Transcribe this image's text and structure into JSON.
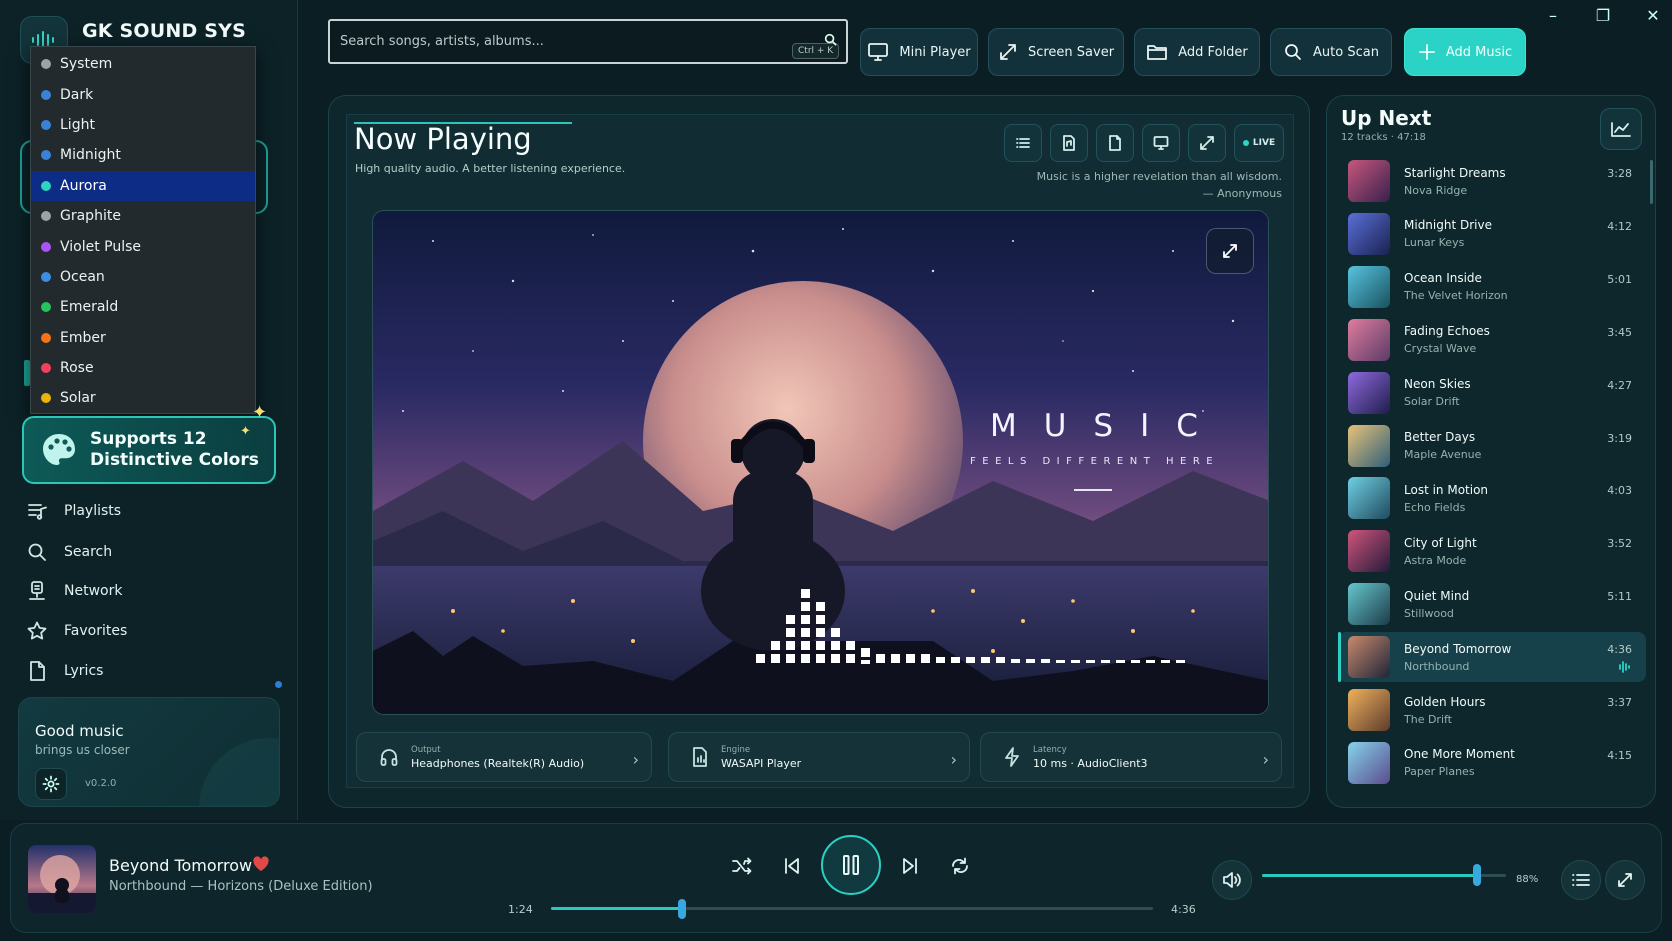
{
  "app": {
    "title": "GK SOUND SYS"
  },
  "theme_menu": [
    {
      "label": "System",
      "color": "#9aa3a8",
      "selected": false
    },
    {
      "label": "Dark",
      "color": "#3b82d6",
      "selected": false
    },
    {
      "label": "Light",
      "color": "#3b82d6",
      "selected": false
    },
    {
      "label": "Midnight",
      "color": "#3b82d6",
      "selected": false
    },
    {
      "label": "Aurora",
      "color": "#2dd4bf",
      "selected": true
    },
    {
      "label": "Graphite",
      "color": "#9aa3a8",
      "selected": false
    },
    {
      "label": "Violet Pulse",
      "color": "#a855f7",
      "selected": false
    },
    {
      "label": "Ocean",
      "color": "#3b8fe0",
      "selected": false
    },
    {
      "label": "Emerald",
      "color": "#22c55e",
      "selected": false
    },
    {
      "label": "Ember",
      "color": "#f97316",
      "selected": false
    },
    {
      "label": "Rose",
      "color": "#f43f5e",
      "selected": false
    },
    {
      "label": "Solar",
      "color": "#eab308",
      "selected": false
    }
  ],
  "promo": {
    "line1": "Supports 12",
    "line2": "Distinctive Colors"
  },
  "nav": [
    {
      "label": "Playlists",
      "icon": "playlist-icon"
    },
    {
      "label": "Search",
      "icon": "search-icon"
    },
    {
      "label": "Network",
      "icon": "network-icon"
    },
    {
      "label": "Favorites",
      "icon": "star-icon"
    },
    {
      "label": "Lyrics",
      "icon": "document-icon"
    }
  ],
  "card": {
    "title": "Good music",
    "subtitle": "brings us closer",
    "version": "v0.2.0"
  },
  "search": {
    "placeholder": "Search songs, artists, albums...",
    "shortcut": "Ctrl + K"
  },
  "toolbar": {
    "mini_player": "Mini Player",
    "screen_saver": "Screen Saver",
    "add_folder": "Add Folder",
    "auto_scan": "Auto Scan",
    "add_music": "Add Music"
  },
  "now_playing": {
    "title": "Now Playing",
    "subtitle": "High quality audio. A better listening experience.",
    "quote": "Music is a higher revelation than all wisdom.",
    "quote_author": "— Anonymous",
    "live_label": "LIVE",
    "art_title": "MUSIC",
    "art_subtitle": "FEELS DIFFERENT HERE"
  },
  "info": {
    "output_label": "Output",
    "output_value": "Headphones (Realtek(R) Audio)",
    "engine_label": "Engine",
    "engine_value": "WASAPI Player",
    "latency_label": "Latency",
    "latency_value": "10 ms · AudioClient3"
  },
  "up_next": {
    "title": "Up Next",
    "summary": "12 tracks · 47:18",
    "tracks": [
      {
        "title": "Starlight Dreams",
        "artist": "Nova Ridge",
        "duration": "3:28",
        "active": false
      },
      {
        "title": "Midnight Drive",
        "artist": "Lunar Keys",
        "duration": "4:12",
        "active": false
      },
      {
        "title": "Ocean Inside",
        "artist": "The Velvet Horizon",
        "duration": "5:01",
        "active": false
      },
      {
        "title": "Fading Echoes",
        "artist": "Crystal Wave",
        "duration": "3:45",
        "active": false
      },
      {
        "title": "Neon Skies",
        "artist": "Solar Drift",
        "duration": "4:27",
        "active": false
      },
      {
        "title": "Better Days",
        "artist": "Maple Avenue",
        "duration": "3:19",
        "active": false
      },
      {
        "title": "Lost in Motion",
        "artist": "Echo Fields",
        "duration": "4:03",
        "active": false
      },
      {
        "title": "City of Light",
        "artist": "Astra Mode",
        "duration": "3:52",
        "active": false
      },
      {
        "title": "Quiet Mind",
        "artist": "Stillwood",
        "duration": "5:11",
        "active": false
      },
      {
        "title": "Beyond Tomorrow",
        "artist": "Northbound",
        "duration": "4:36",
        "active": true
      },
      {
        "title": "Golden Hours",
        "artist": "The Drift",
        "duration": "3:37",
        "active": false
      },
      {
        "title": "One More Moment",
        "artist": "Paper Planes",
        "duration": "4:15",
        "active": false
      }
    ]
  },
  "player": {
    "title": "Beyond Tomorrow",
    "subtitle": "Northbound — Horizons (Deluxe Edition)",
    "elapsed": "1:24",
    "total": "4:36",
    "progress_fraction": 0.2174,
    "volume": "88%",
    "volume_fraction": 0.88
  },
  "colors": {
    "accent": "#2ad3c5",
    "selection": "#0d2c86",
    "heart": "#e34848"
  }
}
